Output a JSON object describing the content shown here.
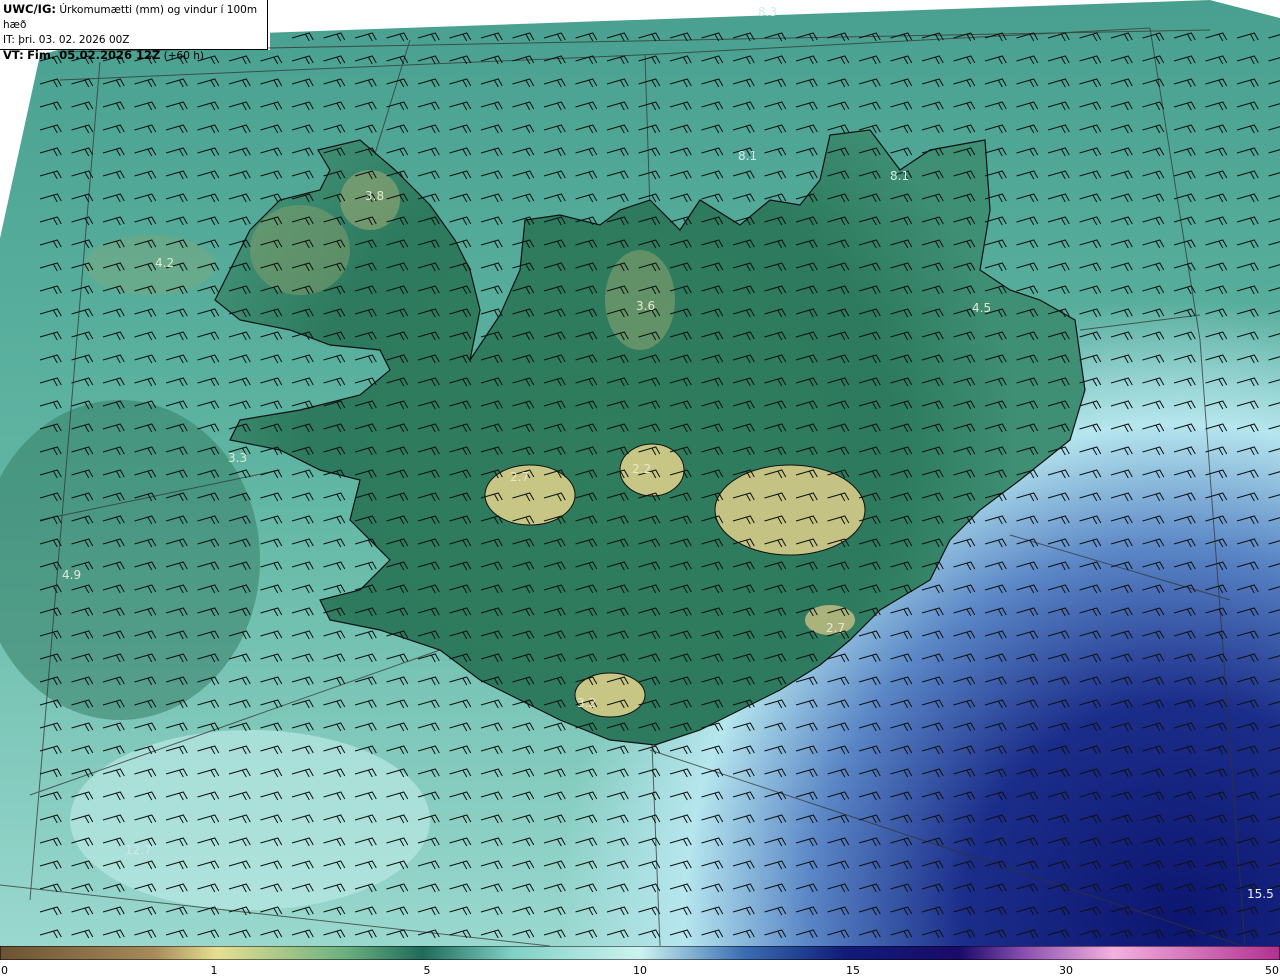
{
  "header": {
    "product": "UWC/IG:",
    "title": "Úrkomumætti (mm) og vindur í 100m hæð",
    "init_time": "IT: þri. 03. 02. 2026 00Z",
    "valid_label": "VT:",
    "valid_time": "Fim. 05.02.2026 12Z",
    "lead": "(+60 h)"
  },
  "colorbar": {
    "ticks": [
      "0",
      "1",
      "5",
      "10",
      "15",
      "30",
      "50"
    ],
    "colors": [
      "#6b5233",
      "#a68a5a",
      "#e6df92",
      "#5aa878",
      "#1f6b5a",
      "#7fd0c5",
      "#cdf3f0",
      "#3a6fb4",
      "#101c78",
      "#1a0a6a",
      "#8a4fb0",
      "#f4b0e0",
      "#b03090"
    ]
  },
  "map_labels": [
    "8.3",
    "8.1",
    "3.8",
    "4.2",
    "8.1",
    "3.6",
    "4.5",
    "3.3",
    "2.7",
    "2.2",
    "4.9",
    "2.7",
    "3.2",
    "12.7",
    "15.5"
  ],
  "icons": {
    "coastline": "iceland-coastline",
    "wind": "wind-barb"
  }
}
